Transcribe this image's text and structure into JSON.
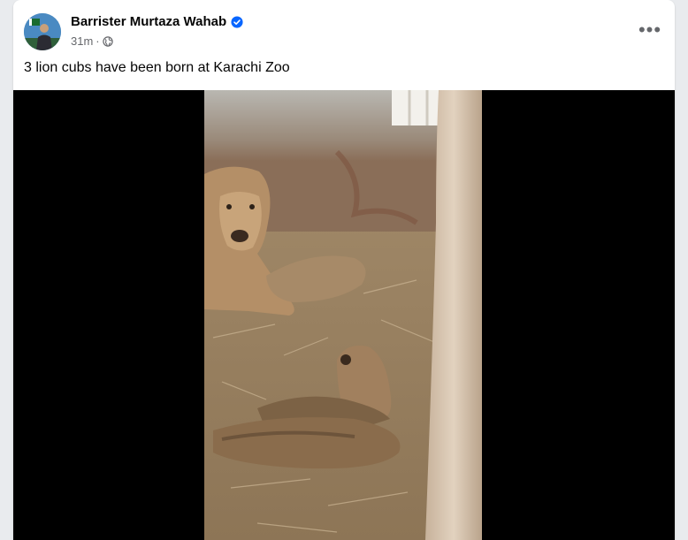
{
  "post": {
    "author": "Barrister Murtaza Wahab",
    "time": "31m",
    "separator": "·",
    "privacy_icon": "globe-icon",
    "verified_icon": "verified-badge-icon",
    "more_label": "•••",
    "text": "3 lion cubs have been born at Karachi Zoo",
    "media_type": "video"
  },
  "colors": {
    "accent_verified": "#0866ff",
    "text_primary": "#050505",
    "text_secondary": "#65676b",
    "media_background": "#000000"
  }
}
